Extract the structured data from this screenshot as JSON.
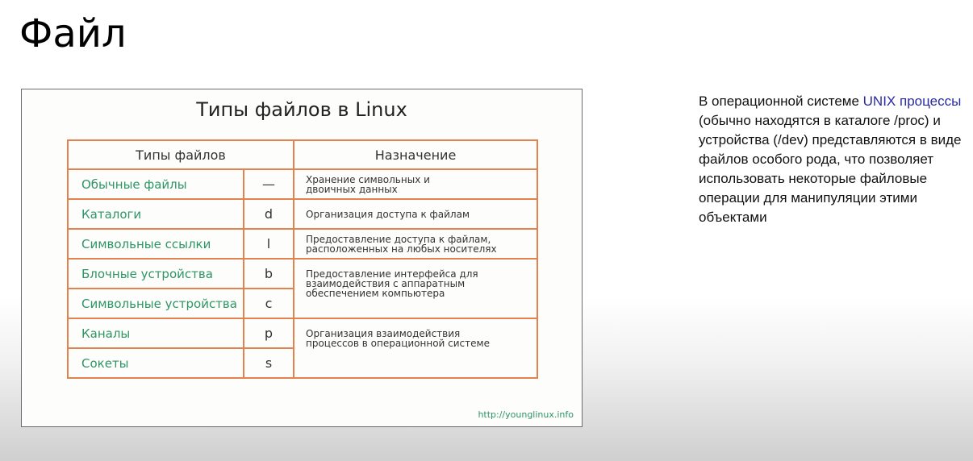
{
  "slide": {
    "title": "Файл"
  },
  "figure": {
    "title": "Типы файлов в Linux",
    "headers": {
      "types": "Типы файлов",
      "purpose": "Назначение"
    },
    "rows": [
      {
        "name": "Обычные файлы",
        "symbol": "—"
      },
      {
        "name": "Каталоги",
        "symbol": "d"
      },
      {
        "name": "Символьные ссылки",
        "symbol": "l"
      },
      {
        "name": "Блочные устройства",
        "symbol": "b"
      },
      {
        "name": "Символьные устройства",
        "symbol": "c"
      },
      {
        "name": "Каналы",
        "symbol": "p"
      },
      {
        "name": "Сокеты",
        "symbol": "s"
      }
    ],
    "purposes": {
      "regular": [
        "Хранение символьных и",
        "двоичных данных"
      ],
      "dirs": [
        "Организация доступа к файлам"
      ],
      "links": [
        "Предоставление доступа к файлам,",
        "расположенных на любых носителях"
      ],
      "devices": [
        "Предоставление интерфейса для",
        "взаимодействия с аппаратным",
        "обеспечением компьютера"
      ],
      "ipc": [
        "Организация взаимодействия",
        "процессов в операционной системе"
      ]
    },
    "url": "http://younglinux.info"
  },
  "side_text": {
    "part1": "В операционной системе ",
    "unix": "UNIX",
    "processes": "процессы",
    "part2": " (обычно находятся в каталоге /proc) и устройства (/dev) представляются в виде файлов особого рода, что позволяет использовать некоторые файловые операции для манипуляции этими объектами"
  },
  "colors": {
    "table_border": "#e2824e",
    "type_name": "#2e9566",
    "highlight": "#2a2aa6"
  }
}
